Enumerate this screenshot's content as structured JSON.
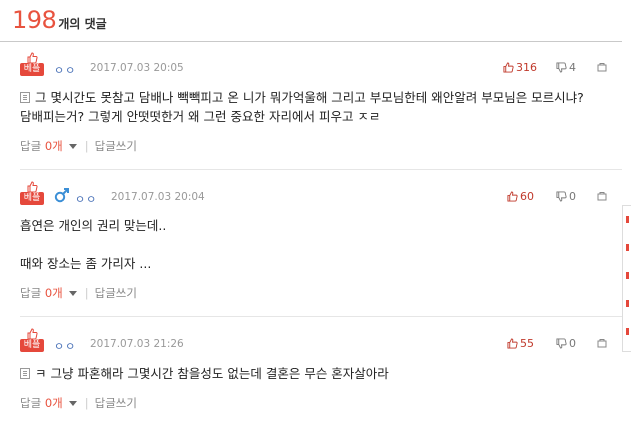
{
  "header": {
    "count": "198",
    "count_suffix": "개의 댓글"
  },
  "colors": {
    "accent": "#e8533f",
    "badge": "#e5483b",
    "nick": "#4a72b8"
  },
  "comments": [
    {
      "badge": "베플",
      "nick": "ㅇㅇ",
      "gender_icon": "",
      "date": "2017.07.03 20:05",
      "likes": "316",
      "dislikes": "4",
      "body": [
        "그 몇시간도 못참고 담배나 빽빽피고 온 니가 뭐가억울해 그리고 부모님한테 왜안알려 부모님은 모르시냐?",
        "담배피는거? 그렇게 안떳떳한거 왜 그런 중요한 자리에서 피우고 ㅈㄹ"
      ],
      "reply_label": "답글",
      "reply_count": "0개",
      "write_reply": "답글쓰기"
    },
    {
      "badge": "베플",
      "nick": "ㅇㅇ",
      "gender_icon": "male-icon",
      "date": "2017.07.03 20:04",
      "likes": "60",
      "dislikes": "0",
      "body": [
        "흡연은 개인의 권리 맞는데..",
        "",
        "때와 장소는 좀 가리자 ..."
      ],
      "reply_label": "답글",
      "reply_count": "0개",
      "write_reply": "답글쓰기"
    },
    {
      "badge": "베플",
      "nick": "ㅇㅇ",
      "gender_icon": "",
      "date": "2017.07.03 21:26",
      "likes": "55",
      "dislikes": "0",
      "body": [
        "ㅋ 그냥 파혼해라 그몇시간 참을성도 없는데 결혼은 무슨 혼자살아라"
      ],
      "reply_label": "답글",
      "reply_count": "0개",
      "write_reply": "답글쓰기"
    }
  ]
}
